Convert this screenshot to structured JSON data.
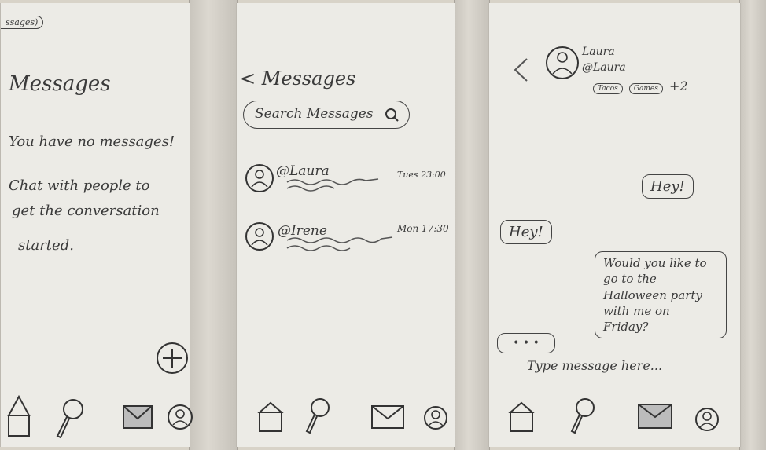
{
  "screen1": {
    "tab_fragment": "ssages)",
    "title": "Messages",
    "empty_title": "You have no messages!",
    "empty_body_lines": [
      "Chat with people to",
      "get the conversation",
      "started."
    ]
  },
  "screen2": {
    "back_label": "< Messages",
    "search_placeholder": "Search Messages",
    "conversations": [
      {
        "name": "@Laura",
        "time": "Tues 23:00"
      },
      {
        "name": "@Irene",
        "time": "Mon 17:30"
      }
    ]
  },
  "screen3": {
    "contact_name": "Laura",
    "contact_handle": "@Laura",
    "tags": [
      "Tacos",
      "Games"
    ],
    "tags_more": "+2",
    "messages": [
      {
        "side": "right",
        "text": "Hey!"
      },
      {
        "side": "left",
        "text": "Hey!"
      },
      {
        "side": "right",
        "text": "Would you like to go to the Halloween party with me on Friday?"
      }
    ],
    "typing_indicator": "• • •",
    "input_placeholder": "Type message here..."
  },
  "icons": {
    "home": "home-icon",
    "search": "search-icon",
    "mail": "mail-icon",
    "profile": "profile-icon",
    "add": "add-icon",
    "avatar": "avatar-icon"
  }
}
